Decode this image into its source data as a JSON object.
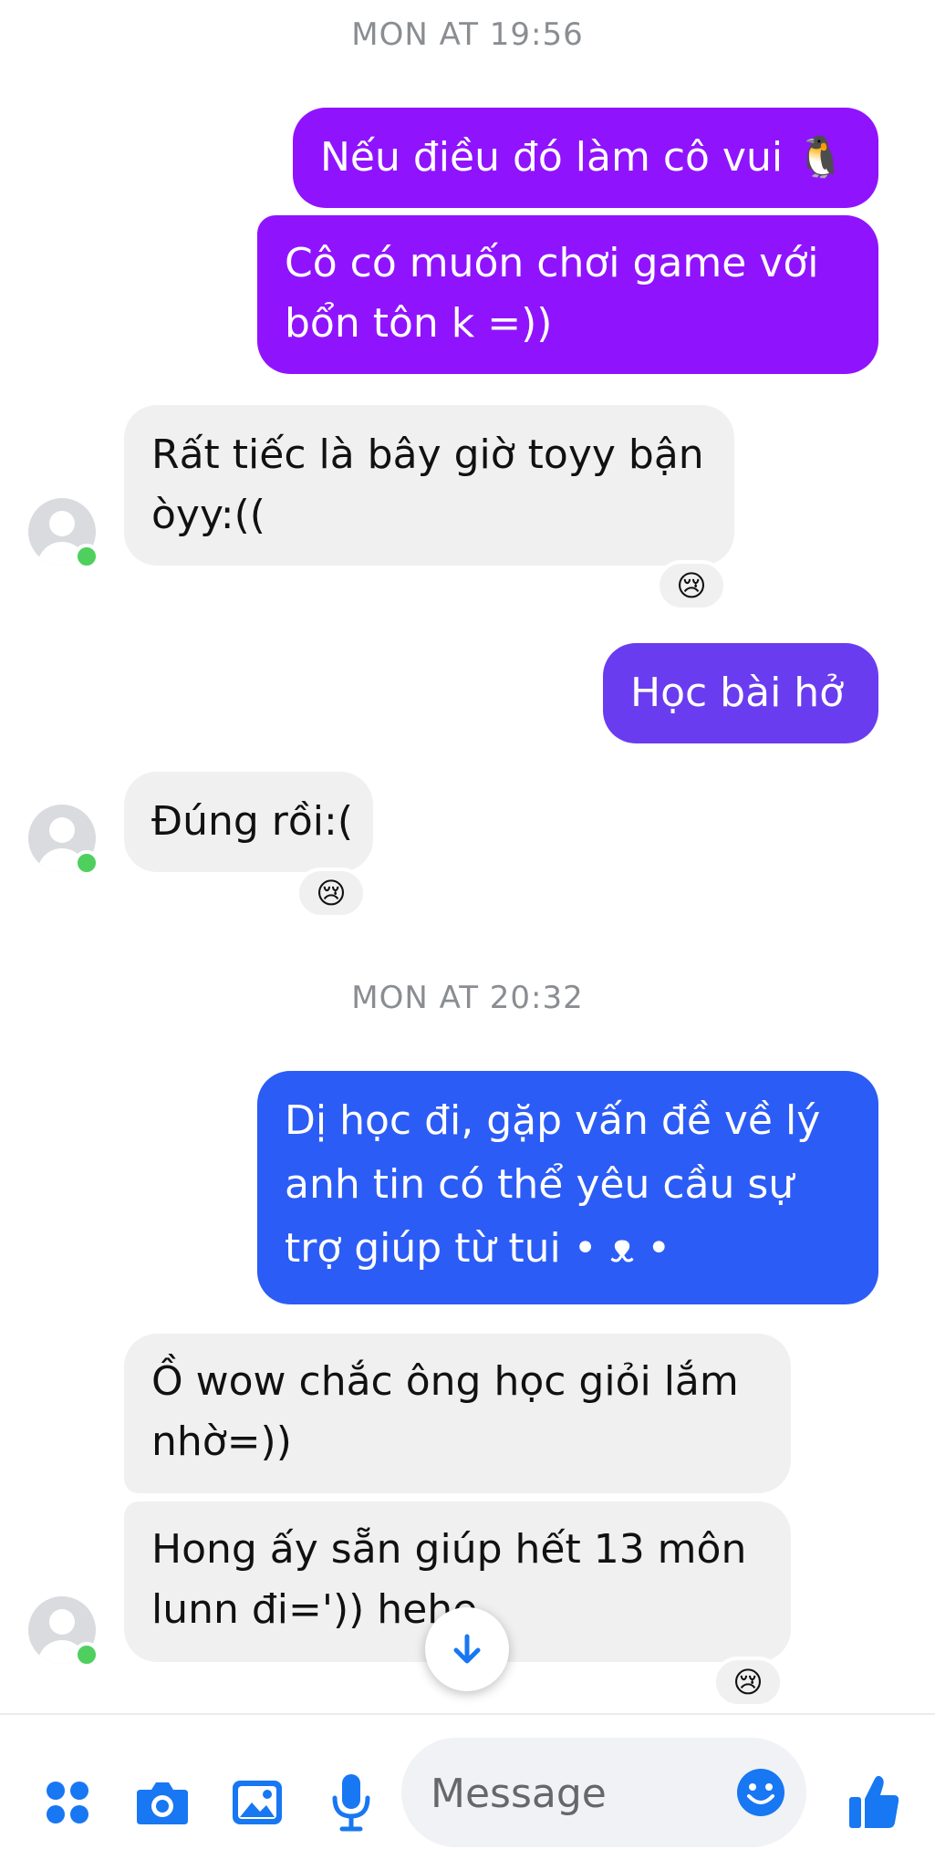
{
  "colors": {
    "bubble_purple": "#9013fe",
    "bubble_violet": "#6a3cf0",
    "bubble_blue": "#2c5cf6",
    "incoming_bubble": "#f0f0f0",
    "accent_blue": "#1877f2",
    "online_green": "#4fd05e"
  },
  "conversation": {
    "timestamp_1": "MON AT 19:56",
    "timestamp_2": "MON AT 20:32",
    "messages": [
      {
        "direction": "out",
        "lines": [
          "Nếu điều đó làm cô vui 🐧"
        ]
      },
      {
        "direction": "out",
        "lines": [
          "Cô có muốn chơi game với",
          "bổn tôn k =))"
        ]
      },
      {
        "direction": "in",
        "lines": [
          "Rất tiếc là bây giờ toyy bận",
          "òyy:(("
        ],
        "reaction": "😢"
      },
      {
        "direction": "out",
        "lines": [
          "Học bài hở"
        ]
      },
      {
        "direction": "in",
        "lines": [
          "Đúng rồi:("
        ],
        "reaction": "😢"
      },
      {
        "direction": "out",
        "lines": [
          "Dị học đi, gặp vấn đề về lý",
          "anh tin có thể yêu cầu sự",
          "trợ giúp từ tui • ᴥ •"
        ]
      },
      {
        "direction": "in",
        "lines": [
          "Ồ wow chắc ông học giỏi lắm",
          "nhờ=))"
        ]
      },
      {
        "direction": "in",
        "lines": [
          "Hong ấy sẵn giúp hết 13 môn",
          "lunn đi=')) hehe"
        ],
        "reaction": "😢"
      }
    ]
  },
  "composer": {
    "placeholder": "Message",
    "icons": [
      "menu-dots-icon",
      "camera-icon",
      "gallery-icon",
      "microphone-icon",
      "emoji-icon",
      "like-icon",
      "scroll-down-icon"
    ]
  }
}
